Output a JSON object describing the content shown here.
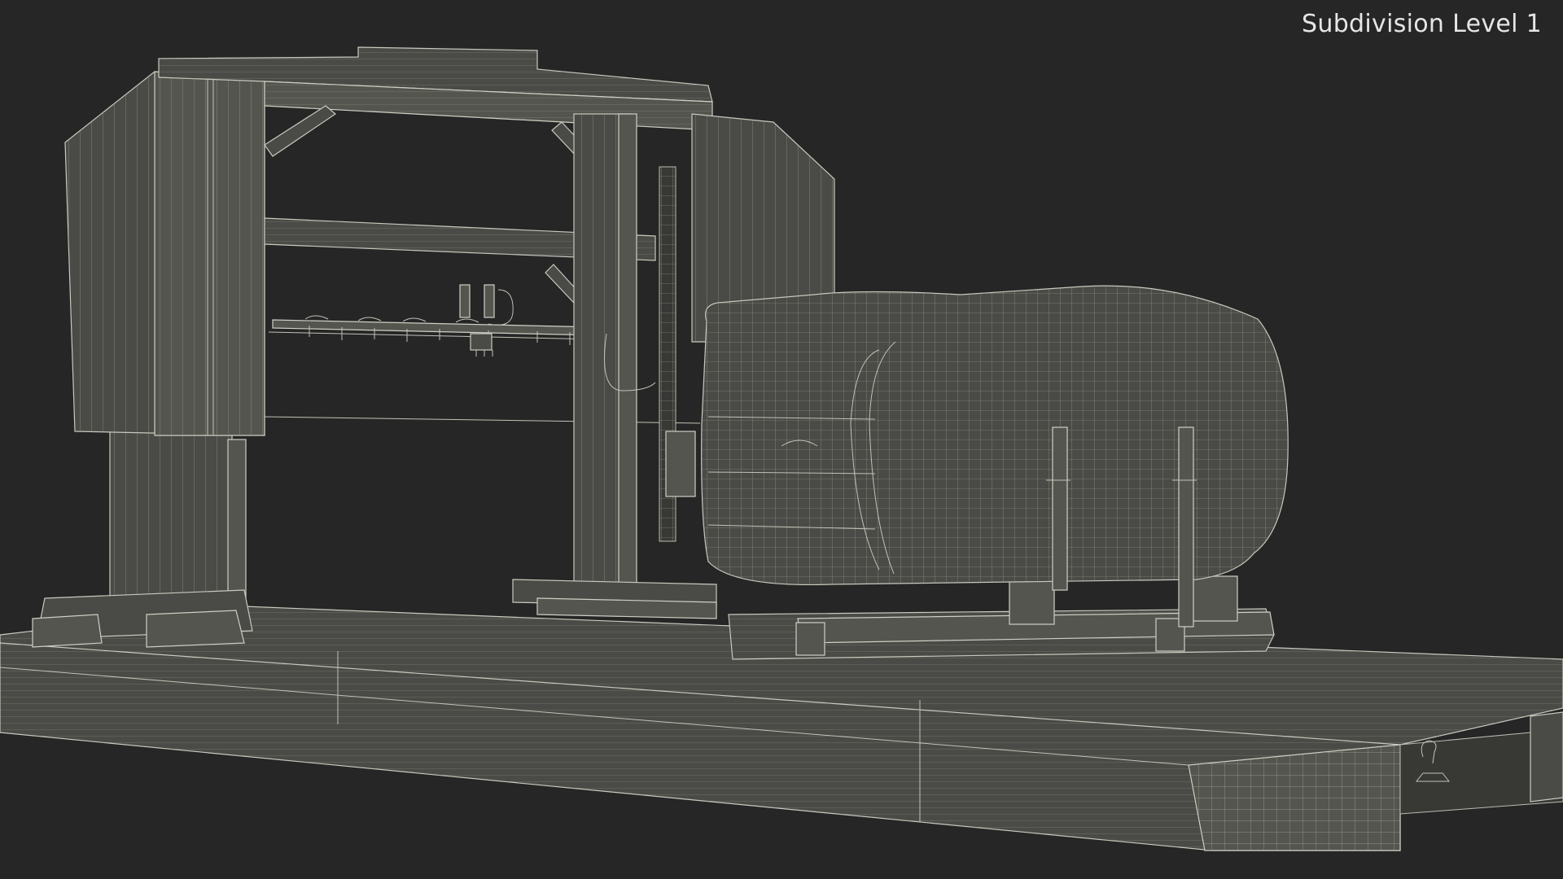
{
  "viewport": {
    "label": "Subdivision Level 1"
  },
  "scene": {
    "background": "#262626",
    "wire_color": "#c9c9bf",
    "surface_color": "#4a4a46"
  }
}
